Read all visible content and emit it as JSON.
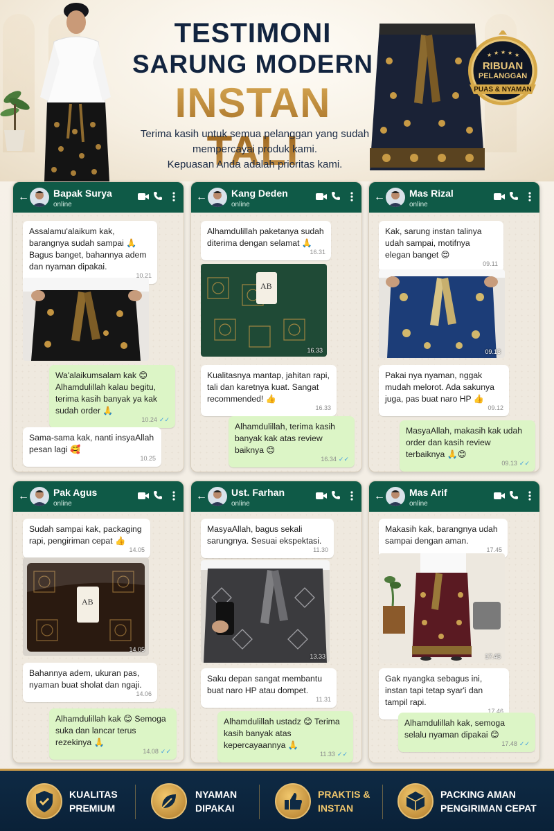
{
  "header": {
    "title_line1": "TESTIMONI",
    "title_line2": "SARUNG MODERN",
    "title_line3": "INSTAN TALI",
    "subtitle": "Terima kasih untuk semua pelanggan yang sudah mempercayai produk kami. Kepuasan Anda adalah prioritas kami.",
    "subtitle_line1": "Terima kasih untuk semua pelanggan yang sudah",
    "subtitle_line2": "mempercayai produk kami.",
    "subtitle_line3": "Kepuasan Anda adalah prioritas kami.",
    "badge": {
      "line1": "RIBUAN",
      "line2": "PELANGGAN",
      "line3": "PUAS & NYAMAN"
    }
  },
  "chats": [
    {
      "name": "Bapak Surya",
      "status": "online",
      "msgs": [
        {
          "text": "Assalamu'alaikum kak, barangnya sudah sampai 🙏 Bagus banget, bahannya adem dan nyaman dipakai.",
          "time": "10.21"
        },
        {
          "photo_time": ""
        },
        {
          "text": "Wa'alaikumsalam kak 😊 Alhamdulillah kalau begitu, terima kasih banyak ya kak sudah order 🙏",
          "time": "10.24"
        },
        {
          "text": "Sama-sama kak, nanti insyaAllah pesan lagi 🥰",
          "time": "10.25"
        }
      ]
    },
    {
      "name": "Kang Deden",
      "status": "online",
      "msgs": [
        {
          "text": "Alhamdulillah paketanya sudah diterima dengan selamat 🙏",
          "time": "16.31"
        },
        {
          "photo_time": "16.33",
          "tag": "AB"
        },
        {
          "text": "Kualitasnya mantap, jahitan rapi, tali dan karetnya kuat. Sangat recommended! 👍",
          "time": "16.33"
        },
        {
          "text": "Alhamdulillah, terima kasih banyak kak atas review baiknya 😊",
          "time": "16.34"
        }
      ]
    },
    {
      "name": "Mas Rizal",
      "status": "online",
      "msgs": [
        {
          "text": "Kak, sarung instan talinya udah sampai, motifnya elegan banget 😍",
          "time": "09.11"
        },
        {
          "photo_time": "09.13"
        },
        {
          "text": "Pakai nya nyaman, nggak mudah melorot. Ada sakunya juga, pas buat naro HP 👍",
          "time": "09.12"
        },
        {
          "text": "MasyaAllah, makasih kak udah order dan kasih review terbaiknya 🙏😊",
          "time": "09.13"
        }
      ]
    },
    {
      "name": "Pak Agus",
      "status": "online",
      "msgs": [
        {
          "text": "Sudah sampai kak, packaging rapi, pengiriman cepat 👍",
          "time": "14.05"
        },
        {
          "photo_time": "14.05",
          "tag": "AB"
        },
        {
          "text": "Bahannya adem, ukuran pas, nyaman buat sholat dan ngaji.",
          "time": "14.06"
        },
        {
          "text": "Alhamdulillah kak 😊 Semoga suka dan lancar terus rezekinya 🙏",
          "time": "14.08"
        }
      ]
    },
    {
      "name": "Ust. Farhan",
      "status": "online",
      "msgs": [
        {
          "text": "MasyaAllah, bagus sekali sarungnya. Sesuai ekspektasi.",
          "time": "11.30"
        },
        {
          "photo_time": "13.33"
        },
        {
          "text": "Saku depan sangat membantu buat naro HP atau dompet.",
          "time": "11.31"
        },
        {
          "text": "Alhamdulillah ustadz 😊 Terima kasih banyak atas kepercayaannya 🙏",
          "time": "11.33"
        }
      ]
    },
    {
      "name": "Mas Arif",
      "status": "online",
      "msgs": [
        {
          "text": "Makasih kak, barangnya udah sampai dengan aman.",
          "time": "17.45"
        },
        {
          "photo_time": "17.45"
        },
        {
          "text": "Gak nyangka sebagus ini, instan tapi tetap syar'i dan tampil rapi.",
          "time": "17.46"
        },
        {
          "text": "Alhamdulillah kak, semoga selalu nyaman dipakai 😊",
          "time": "17.48"
        }
      ]
    }
  ],
  "features": [
    {
      "icon": "check-shield-icon",
      "line1": "KUALITAS",
      "line2": "PREMIUM"
    },
    {
      "icon": "leaf-icon",
      "line1": "NYAMAN",
      "line2": "DIPAKAI"
    },
    {
      "icon": "thumbs-up-icon",
      "line1": "PRAKTIS &",
      "line2": "INSTAN"
    },
    {
      "icon": "box-icon",
      "line1": "PACKING AMAN",
      "line2": "PENGIRIMAN CEPAT"
    }
  ],
  "colors": {
    "whatsapp_header": "#0f5a47",
    "outgoing_bubble": "#dcf5c6",
    "gold": "#c89a4a",
    "navy": "#12243f"
  }
}
